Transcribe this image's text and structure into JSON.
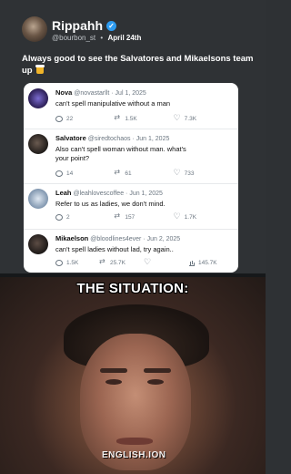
{
  "post": {
    "name": "Rippahh",
    "handle": "@bourbon_st",
    "date": "April 24th",
    "caption": "Always good to see the Salvatores and Mikaelsons team up"
  },
  "tweets": [
    {
      "name": "Nova",
      "handle": "@novastarllt",
      "date": "Jul 1, 2025",
      "text": "can't spell manipulative without a man",
      "replies": "22",
      "retweets": "1.5K",
      "likes": "7.3K",
      "views": "",
      "avatar_color": "#3d2a6e"
    },
    {
      "name": "Salvatore",
      "handle": "@siredtochaos",
      "date": "Jun 1, 2025",
      "text": "Also can't spell woman without man. what's your point?",
      "replies": "14",
      "retweets": "61",
      "likes": "733",
      "views": "",
      "avatar_color": "#2d2a28"
    },
    {
      "name": "Leah",
      "handle": "@leahlovescoffee",
      "date": "Jun 1, 2025",
      "text": "Refer to us as ladies, we don't mind.",
      "replies": "2",
      "retweets": "157",
      "likes": "1.7K",
      "views": "",
      "avatar_color": "#8aa0b8"
    },
    {
      "name": "Mikaelson",
      "handle": "@bloodlines4ever",
      "date": "Jun 2, 2025",
      "text": "can't spell ladies without lad, try again..",
      "replies": "1.5K",
      "retweets": "25.7K",
      "likes": "",
      "views": "145.7K",
      "avatar_color": "#2b2624"
    }
  ],
  "meme": {
    "title": "THE SITUATION:",
    "watermark": "ENGLISH.ION"
  }
}
